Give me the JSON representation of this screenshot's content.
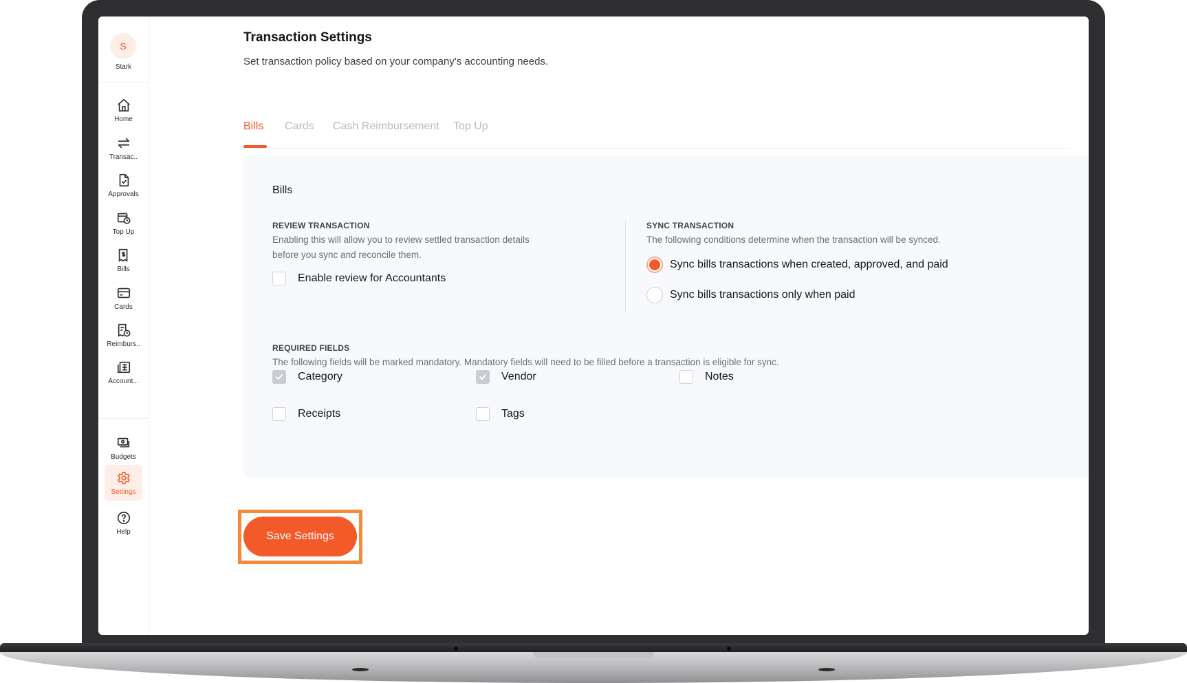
{
  "sidebar": {
    "avatar_initial": "S",
    "company": "Stark",
    "items": [
      {
        "label": "Home"
      },
      {
        "label": "Transac.."
      },
      {
        "label": "Approvals"
      },
      {
        "label": "Top Up"
      },
      {
        "label": "Bills"
      },
      {
        "label": "Cards"
      },
      {
        "label": "Reimburs.."
      },
      {
        "label": "Account..."
      }
    ],
    "bottom_items": [
      {
        "label": "Budgets"
      },
      {
        "label": "Settings",
        "active": true
      },
      {
        "label": "Help"
      }
    ]
  },
  "page": {
    "title": "Transaction Settings",
    "subtitle": "Set transaction policy based on your company's accounting needs."
  },
  "tabs": [
    {
      "label": "Bills",
      "active": true
    },
    {
      "label": "Cards"
    },
    {
      "label": "Cash Reimbursement"
    },
    {
      "label": "Top Up"
    }
  ],
  "panel": {
    "title": "Bills",
    "review": {
      "heading": "REVIEW TRANSACTION",
      "desc_line1": "Enabling this will allow you to review settled transaction details",
      "desc_line2": "before you sync and reconcile them.",
      "checkbox_label": "Enable review for Accountants",
      "checked": false
    },
    "sync": {
      "heading": "SYNC TRANSACTION",
      "desc": "The following conditions determine when the transaction will be synced.",
      "options": [
        {
          "label": "Sync bills transactions when created, approved, and paid",
          "selected": true
        },
        {
          "label": "Sync bills transactions only when paid",
          "selected": false
        }
      ]
    },
    "required": {
      "heading": "REQUIRED FIELDS",
      "desc": "The following fields will be marked mandatory. Mandatory fields will need to be filled before a transaction is eligible for sync.",
      "fields": [
        {
          "label": "Category",
          "checked": true
        },
        {
          "label": "Vendor",
          "checked": true
        },
        {
          "label": "Notes",
          "checked": false
        },
        {
          "label": "Receipts",
          "checked": false
        },
        {
          "label": "Tags",
          "checked": false
        }
      ]
    }
  },
  "save_button": {
    "label": "Save Settings"
  },
  "colors": {
    "accent": "#f25a2a",
    "highlight": "#f78a3a",
    "panel_bg": "#f8f9fc"
  }
}
